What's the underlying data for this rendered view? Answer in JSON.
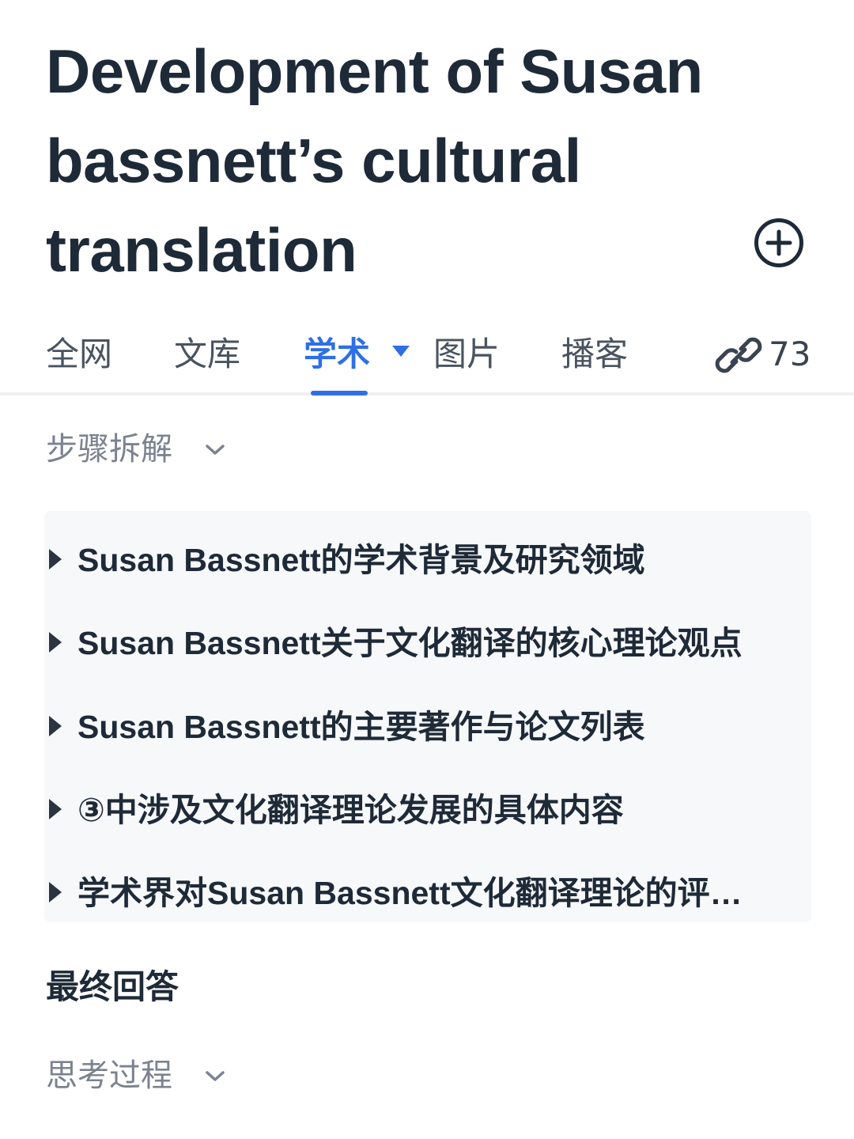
{
  "title": {
    "line1": "Development of Susan",
    "line2": "bassnett’s cultural",
    "line3": "translation"
  },
  "tabs": [
    {
      "label": "全网",
      "active": false
    },
    {
      "label": "文库",
      "active": false
    },
    {
      "label": "学术",
      "active": true
    },
    {
      "label": "图片",
      "active": false
    },
    {
      "label": "播客",
      "active": false
    }
  ],
  "sources_count": "73",
  "steps_section": {
    "label": "步骤拆解",
    "items": [
      "Susan Bassnett的学术背景及研究领域",
      "Susan Bassnett关于文化翻译的核心理论观点",
      "Susan Bassnett的主要著作与论文列表",
      "③中涉及文化翻译理论发展的具体内容",
      "学术界对Susan Bassnett文化翻译理论的评…"
    ]
  },
  "final_answer_label": "最终回答",
  "thinking_section": {
    "label": "思考过程"
  },
  "colors": {
    "accent": "#2f6fe6",
    "title_text": "#1f2a38",
    "muted_text": "#7b8290",
    "steps_background": "#f7f8fa"
  }
}
